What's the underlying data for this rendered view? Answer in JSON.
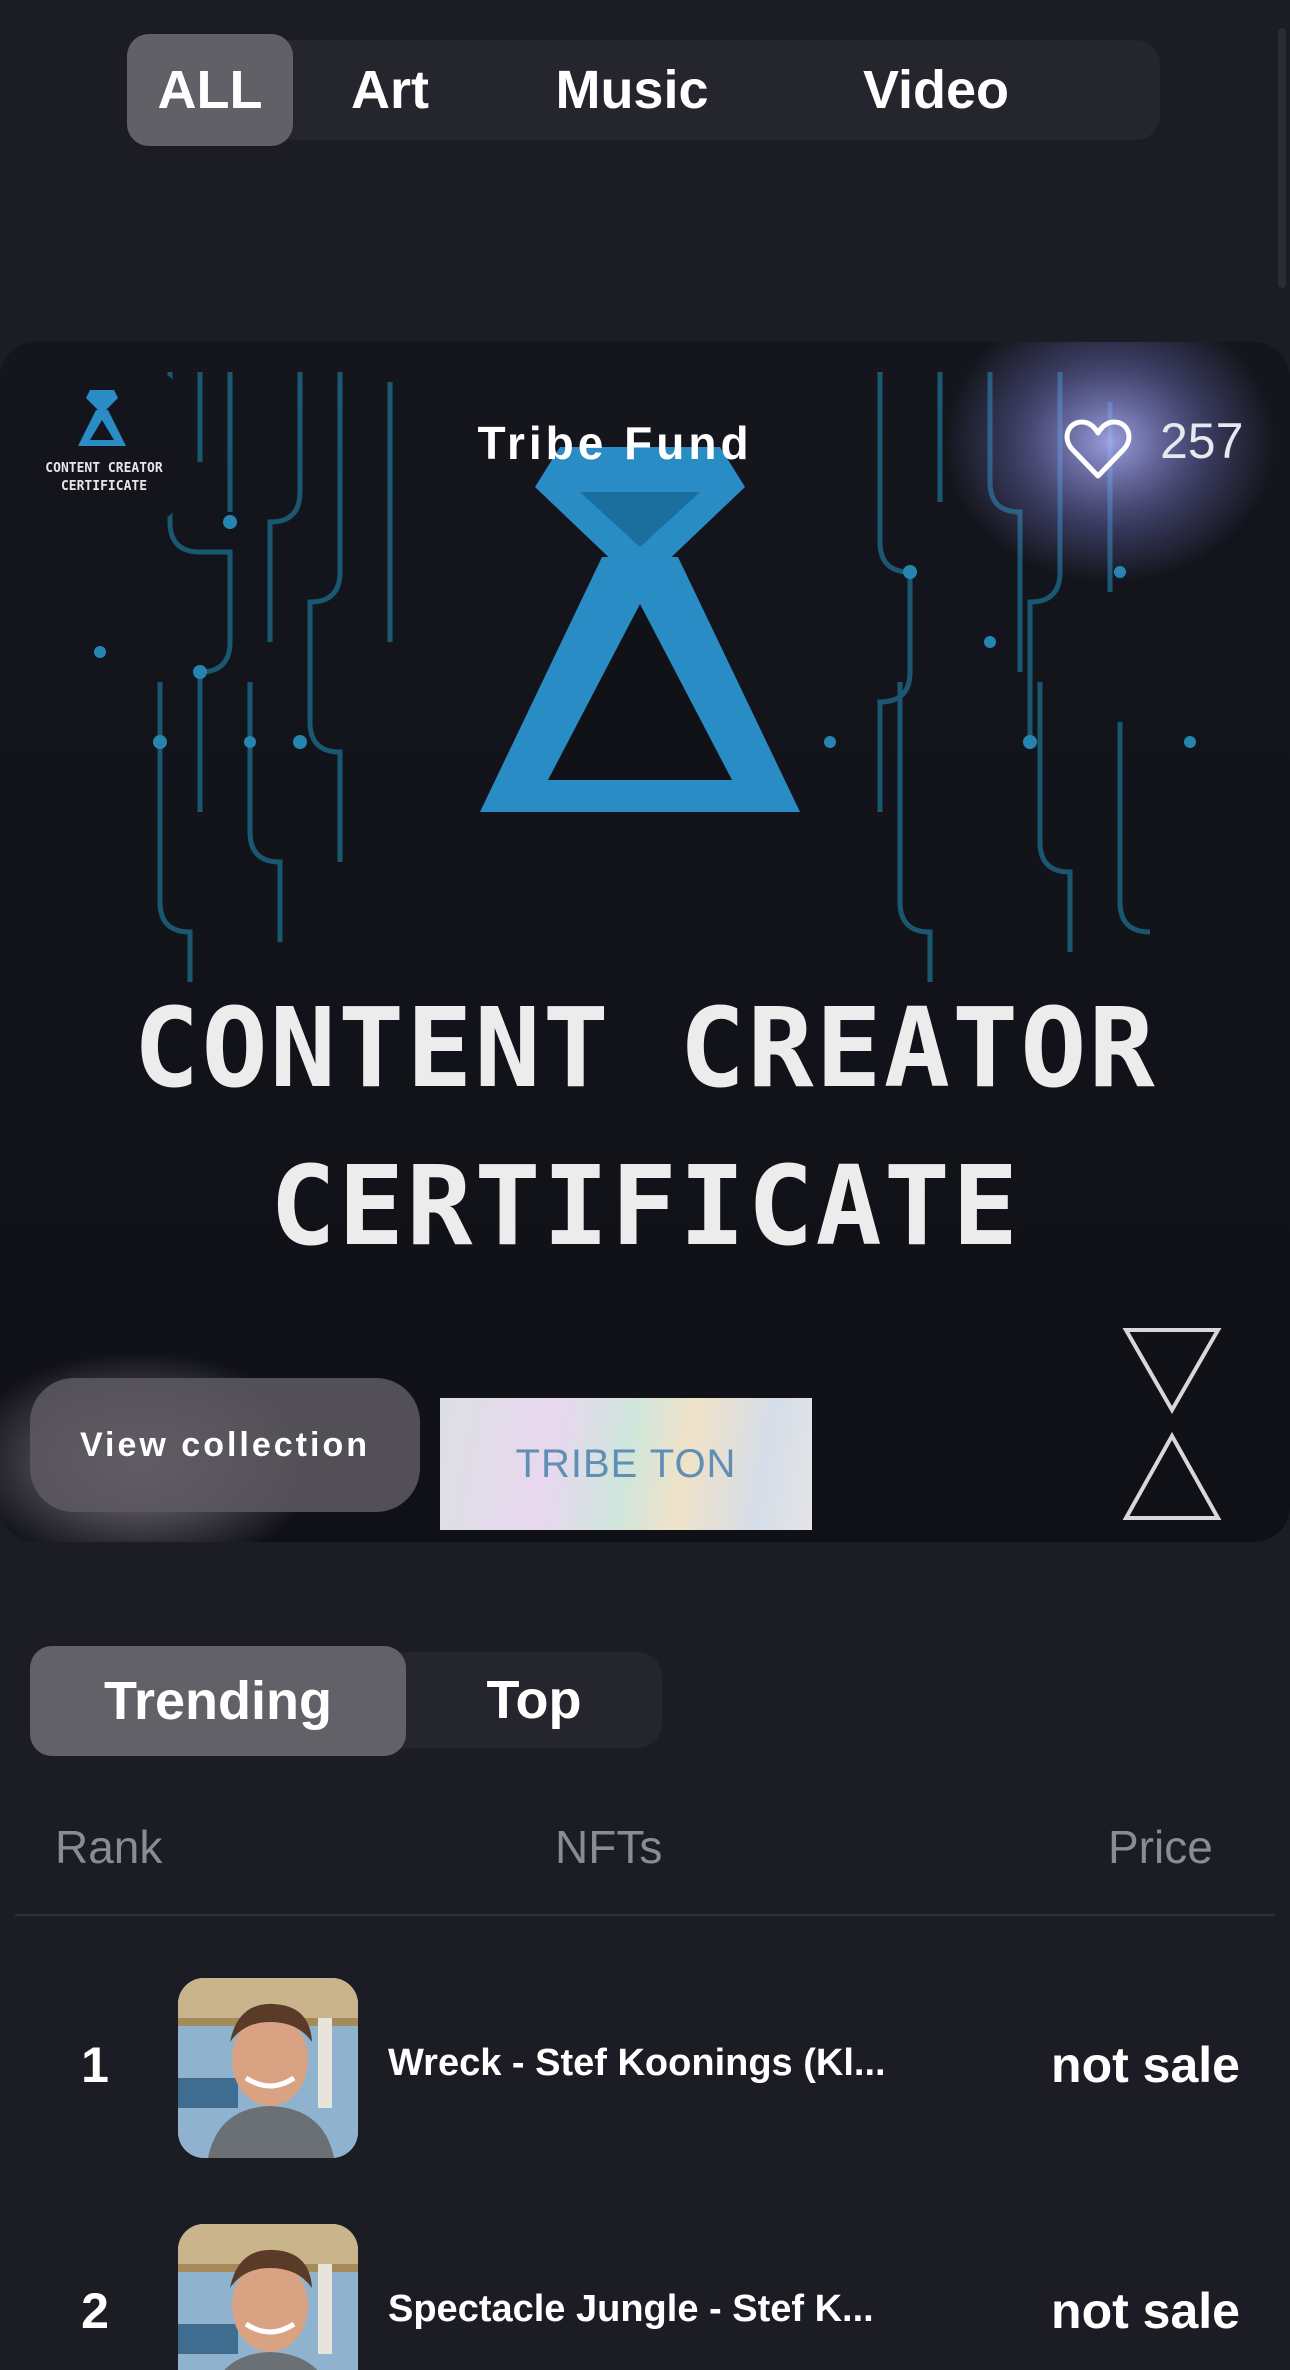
{
  "category_tabs": [
    {
      "label": "ALL",
      "active": true
    },
    {
      "label": "Art",
      "active": false
    },
    {
      "label": "Music",
      "active": false
    },
    {
      "label": "Video",
      "active": false
    }
  ],
  "featured": {
    "collection_name": "Tribe Fund",
    "like_count": "257",
    "thumbnail_caption_line1": "CONTENT  CREATOR",
    "thumbnail_caption_line2": "CERTIFICATE",
    "artwork_title_line1": "CONTENT CREATOR",
    "artwork_title_line2": "CERTIFICATE",
    "view_collection_label": "View collection",
    "tape_text": "TRIBE TON",
    "accent_color": "#2a8cc4",
    "icons": {
      "like": "heart-icon",
      "logo": "tribe-diamond-icon"
    }
  },
  "ranking_tabs": [
    {
      "label": "Trending",
      "active": true
    },
    {
      "label": "Top",
      "active": false
    }
  ],
  "table": {
    "headers": {
      "rank": "Rank",
      "nfts": "NFTs",
      "price": "Price"
    },
    "rows": [
      {
        "rank": "1",
        "name": "Wreck - Stef Koonings (Kl...",
        "price": "not sale"
      },
      {
        "rank": "2",
        "name": "Spectacle Jungle - Stef K...",
        "price": "not sale"
      }
    ]
  }
}
